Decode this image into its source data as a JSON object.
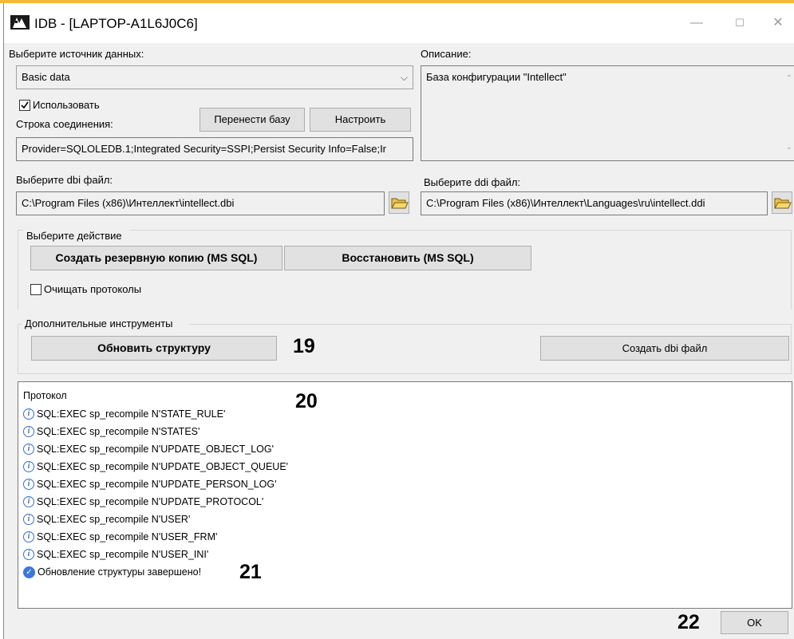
{
  "window": {
    "title": "IDB - [LAPTOP-A1L6J0C6]",
    "controls": {
      "minimize": "—",
      "maximize": "☐",
      "close": "✕"
    }
  },
  "source": {
    "label": "Выберите источник данных:",
    "value": "Basic data",
    "use_checkbox": {
      "label": "Использовать",
      "checked": true
    },
    "connection_label": "Строка соединения:",
    "move_db_button": "Перенести базу",
    "configure_button": "Настроить",
    "connection_string": "Provider=SQLOLEDB.1;Integrated Security=SSPI;Persist Security Info=False;Ir"
  },
  "description": {
    "label": "Описание:",
    "text": "База конфигурации \"Intellect\""
  },
  "dbi": {
    "label": "Выберите dbi файл:",
    "path": "C:\\Program Files (x86)\\Интеллект\\intellect.dbi"
  },
  "ddi": {
    "label": "Выберите ddi файл:",
    "path": "C:\\Program Files (x86)\\Интеллект\\Languages\\ru\\intellect.ddi"
  },
  "action": {
    "group_label": "Выберите действие",
    "backup_button": "Создать резервную копию  (MS SQL)",
    "restore_button": "Восстановить (MS SQL)",
    "clear_logs": {
      "label": "Очищать протоколы",
      "checked": false
    }
  },
  "tools": {
    "group_label": "Дополнительные инструменты",
    "update_structure_button": "Обновить структуру",
    "create_dbi_button": "Создать dbi файл"
  },
  "log": {
    "title": "Протокол",
    "entries": [
      {
        "icon": "info-icon",
        "text": "SQL:EXEC sp_recompile N'STATE_RULE'"
      },
      {
        "icon": "info-icon",
        "text": "SQL:EXEC sp_recompile N'STATES'"
      },
      {
        "icon": "info-icon",
        "text": "SQL:EXEC sp_recompile N'UPDATE_OBJECT_LOG'"
      },
      {
        "icon": "info-icon",
        "text": "SQL:EXEC sp_recompile N'UPDATE_OBJECT_QUEUE'"
      },
      {
        "icon": "info-icon",
        "text": "SQL:EXEC sp_recompile N'UPDATE_PERSON_LOG'"
      },
      {
        "icon": "info-icon",
        "text": "SQL:EXEC sp_recompile N'UPDATE_PROTOCOL'"
      },
      {
        "icon": "info-icon",
        "text": "SQL:EXEC sp_recompile N'USER'"
      },
      {
        "icon": "info-icon",
        "text": "SQL:EXEC sp_recompile N'USER_FRM'"
      },
      {
        "icon": "info-icon",
        "text": "SQL:EXEC sp_recompile N'USER_INI'"
      },
      {
        "icon": "check-icon",
        "text": "Обновление структуры завершено!"
      }
    ]
  },
  "ok_button": "OK",
  "markers": {
    "m19": "19",
    "m20": "20",
    "m21": "21",
    "m22": "22"
  },
  "colors": {
    "accent_strip": "#f6b73c",
    "info_blue": "#3c6ec8"
  }
}
